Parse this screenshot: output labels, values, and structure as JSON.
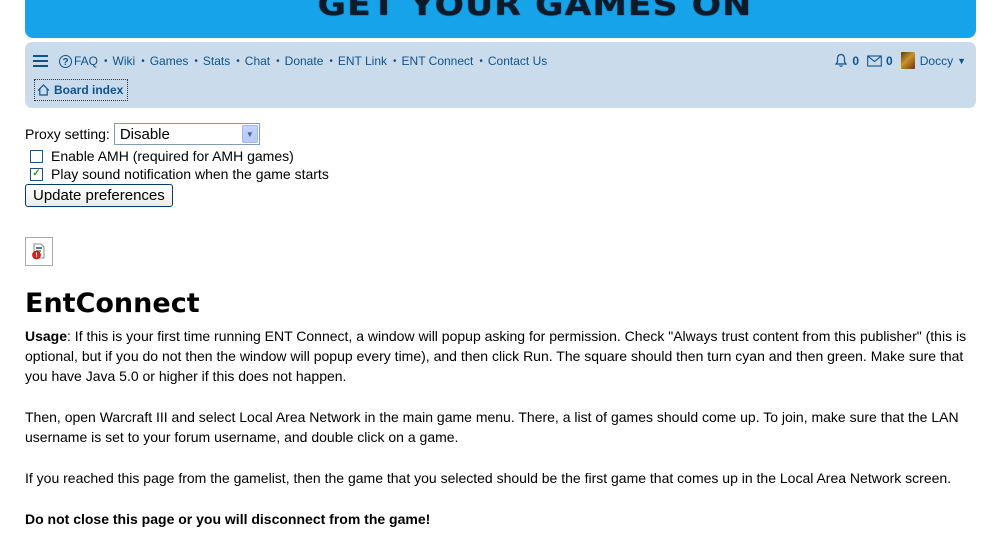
{
  "banner": {
    "text": "GET YOUR GAMES ON"
  },
  "navbar": {
    "links": [
      {
        "label": "FAQ",
        "icon": "help-icon"
      },
      {
        "label": "Wiki"
      },
      {
        "label": "Games"
      },
      {
        "label": "Stats"
      },
      {
        "label": "Chat"
      },
      {
        "label": "Donate"
      },
      {
        "label": "ENT Link"
      },
      {
        "label": "ENT Connect"
      },
      {
        "label": "Contact Us"
      }
    ],
    "notifications_count": "0",
    "messages_count": "0",
    "username": "Doccy",
    "breadcrumb": "Board index",
    "link_color": "#105289",
    "bg_color": "#cadceb"
  },
  "prefs": {
    "proxy_label": "Proxy setting:",
    "proxy_value": "Disable",
    "amh_label": "Enable AMH (required for AMH games)",
    "amh_checked": false,
    "sound_label": "Play sound notification when the game starts",
    "sound_checked": true,
    "update_button": "Update preferences"
  },
  "content": {
    "title": "EntConnect",
    "usage_label": "Usage",
    "usage_text": ": If this is your first time running ENT Connect, a window will popup asking for permission. Check \"Always trust content from this publisher\" (this is optional, but if you do not then the window will popup every time), and then click Run. The square should then turn cyan and then green. Make sure that you have Java 5.0 or higher if this does not happen.",
    "paragraph2": "Then, open Warcraft III and select Local Area Network in the main game menu. There, a list of games should come up. To join, make sure that the LAN username is set to your forum username, and double click on a game.",
    "paragraph3": "If you reached this page from the gamelist, then the game that you selected should be the first game that comes up in the Local Area Network screen.",
    "warning": "Do not close this page or you will disconnect from the game!"
  },
  "colors": {
    "banner": "#16a3e9"
  }
}
